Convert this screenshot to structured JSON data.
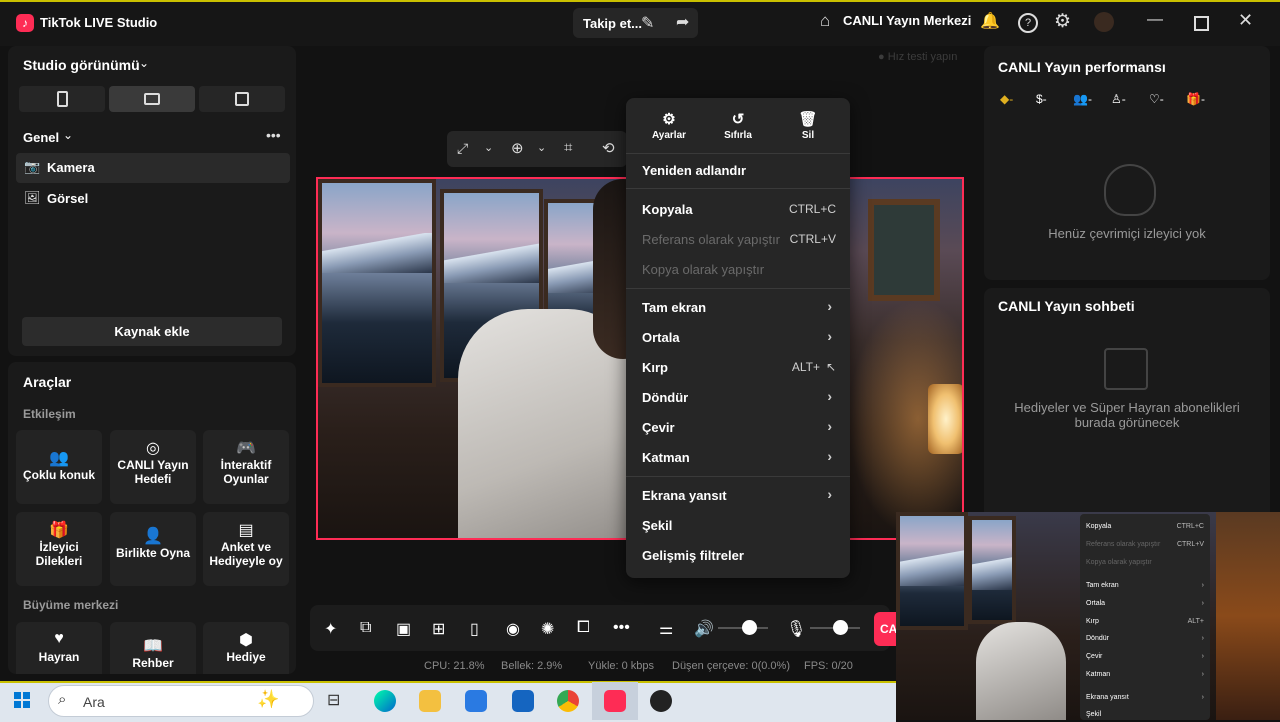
{
  "titlebar": {
    "app_title": "TikTok LIVE Studio",
    "follow_label": "Takip et...",
    "live_center": "CANLI Yayın Merkezi"
  },
  "left": {
    "studio_view_title": "Studio görünümü",
    "general_title": "Genel",
    "sources": [
      {
        "label": "Kamera",
        "icon": "camera-icon"
      },
      {
        "label": "Görsel",
        "icon": "image-icon"
      }
    ],
    "add_source": "Kaynak ekle",
    "tools_title": "Araçlar",
    "interaction_title": "Etkileşim",
    "tools": [
      {
        "label": "Çoklu konuk",
        "icon": "multi-guest-icon"
      },
      {
        "label": "CANLI Yayın Hedefi",
        "icon": "goal-icon"
      },
      {
        "label": "İnteraktif Oyunlar",
        "icon": "gamepad-icon"
      },
      {
        "label": "İzleyici Dilekleri",
        "icon": "gift-wish-icon"
      },
      {
        "label": "Birlikte Oyna",
        "icon": "play-together-icon"
      },
      {
        "label": "Anket ve Hediyeyle oy",
        "icon": "poll-icon"
      }
    ],
    "growth_title": "Büyüme merkezi",
    "growth_tools": [
      {
        "label": "Hayran",
        "icon": "fan-icon"
      },
      {
        "label": "Rehber",
        "icon": "guide-icon"
      },
      {
        "label": "Hediye",
        "icon": "gift-icon"
      }
    ]
  },
  "preview": {
    "speed_test": "Hız testi yapın"
  },
  "context_menu": {
    "top": [
      {
        "label": "Ayarlar",
        "icon": "settings-icon"
      },
      {
        "label": "Sıfırla",
        "icon": "reset-icon"
      },
      {
        "label": "Sil",
        "icon": "trash-icon"
      }
    ],
    "items": [
      {
        "label": "Yeniden adlandır",
        "shortcut": ""
      },
      {
        "label": "Kopyala",
        "shortcut": "CTRL+C"
      },
      {
        "label": "Referans olarak yapıştır",
        "shortcut": "CTRL+V"
      },
      {
        "label": "Kopya olarak yapıştır",
        "shortcut": ""
      },
      {
        "label": "Tam ekran",
        "shortcut": ""
      },
      {
        "label": "Ortala",
        "shortcut": ""
      },
      {
        "label": "Kırp",
        "shortcut": "ALT+"
      },
      {
        "label": "Döndür",
        "shortcut": ""
      },
      {
        "label": "Çevir",
        "shortcut": ""
      },
      {
        "label": "Katman",
        "shortcut": ""
      },
      {
        "label": "Ekrana yansıt",
        "shortcut": ""
      },
      {
        "label": "Şekil",
        "shortcut": ""
      },
      {
        "label": "Gelişmiş filtreler",
        "shortcut": ""
      }
    ]
  },
  "bottom": {
    "live_button": "CA",
    "cpu": "CPU: 21.8%",
    "memory": "Bellek: 2.9%",
    "upload": "Yükle: 0 kbps",
    "dropped": "Düşen çerçeve: 0(0.0%)",
    "fps": "FPS: 0/20"
  },
  "right": {
    "perf_title": "CANLI Yayın performansı",
    "perf_empty": "Henüz çevrimiçi izleyici yok",
    "chat_title": "CANLI Yayın sohbeti",
    "chat_empty": "Hediyeler ve Süper Hayran abonelikleri burada görünecek"
  },
  "taskbar": {
    "search_placeholder": "Ara"
  },
  "webcam_menu": {
    "items": [
      {
        "label": "Kopyala",
        "shortcut": "CTRL+C"
      },
      {
        "label": "Referans olarak yapıştır",
        "shortcut": "CTRL+V"
      },
      {
        "label": "Kopya olarak yapıştır",
        "shortcut": ""
      },
      {
        "label": "Tam ekran",
        "shortcut": ""
      },
      {
        "label": "Ortala",
        "shortcut": ""
      },
      {
        "label": "Kırp",
        "shortcut": "ALT+"
      },
      {
        "label": "Döndür",
        "shortcut": ""
      },
      {
        "label": "Çevir",
        "shortcut": ""
      },
      {
        "label": "Katman",
        "shortcut": ""
      },
      {
        "label": "Ekrana yansıt",
        "shortcut": ""
      },
      {
        "label": "Şekil",
        "shortcut": ""
      }
    ]
  }
}
